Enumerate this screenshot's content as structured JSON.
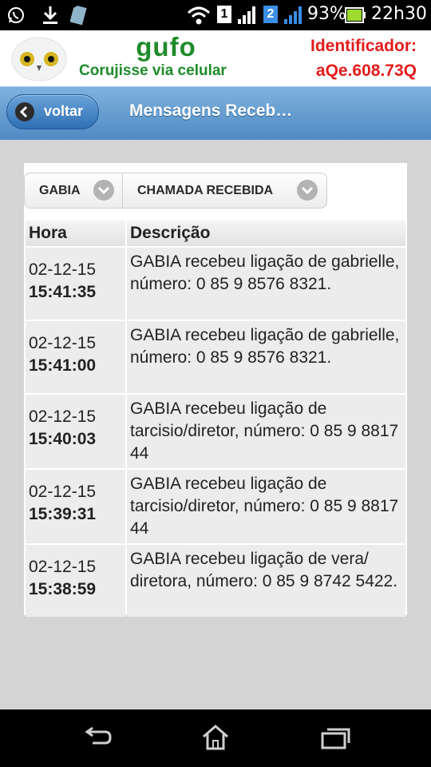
{
  "status_bar": {
    "battery": "93%",
    "time": "22h30",
    "sim1": "1",
    "sim2": "2",
    "icons": [
      "whatsapp-icon",
      "download-icon",
      "sim-card-icon",
      "wifi-icon",
      "signal-icon",
      "battery-icon"
    ]
  },
  "header": {
    "brand": "gufo",
    "tagline": "Corujisse via celular",
    "id_label": "Identificador:",
    "id_value": "aQe.608.73Q"
  },
  "nav": {
    "back_label": "voltar",
    "title": "Mensagens Receb…"
  },
  "filters": {
    "contact": "GABIA",
    "type": "CHAMADA RECEBIDA"
  },
  "table": {
    "headers": {
      "time": "Hora",
      "description": "Descrição"
    },
    "rows": [
      {
        "date": "02-12-15",
        "time": "15:41:35",
        "description": "GABIA recebeu ligação de gabrielle, número: 0 85 9 8576 8321."
      },
      {
        "date": "02-12-15",
        "time": "15:41:00",
        "description": "GABIA recebeu ligação de gabrielle, número: 0 85 9 8576 8321."
      },
      {
        "date": "02-12-15",
        "time": "15:40:03",
        "description": "GABIA recebeu ligação de tarcisio/diretor, número: 0 85 9 8817 44"
      },
      {
        "date": "02-12-15",
        "time": "15:39:31",
        "description": "GABIA recebeu ligação de tarcisio/diretor, número: 0 85 9 8817 44"
      },
      {
        "date": "02-12-15",
        "time": "15:38:59",
        "description": "GABIA recebeu ligação de vera/ diretora, número: 0 85 9 8742 5422."
      }
    ]
  },
  "colors": {
    "brand_green": "#1e8b2a",
    "id_red": "#e31b1b",
    "nav_blue": "#4f8ac3",
    "battery_green": "#9ddc2f",
    "sim_blue": "#3a8ee6"
  },
  "system_nav": [
    "back-icon",
    "home-icon",
    "recent-apps-icon"
  ]
}
